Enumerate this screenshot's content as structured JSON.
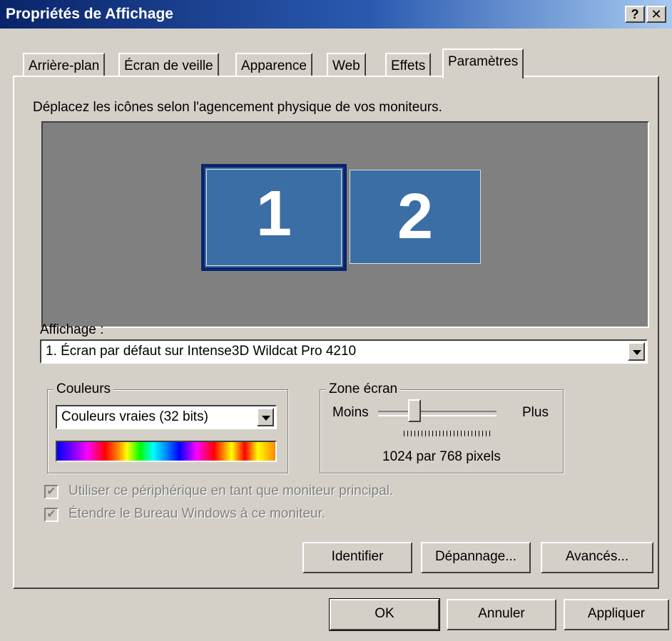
{
  "window": {
    "title": "Propriétés de Affichage",
    "help_label": "?",
    "close_label": "✕"
  },
  "tabs": [
    {
      "label": "Arrière-plan"
    },
    {
      "label": "Écran de veille"
    },
    {
      "label": "Apparence"
    },
    {
      "label": "Web"
    },
    {
      "label": "Effets"
    },
    {
      "label": "Paramètres"
    }
  ],
  "active_tab": "Paramètres",
  "settings": {
    "instruction": "Déplacez les icônes selon l'agencement physique de vos moniteurs.",
    "monitors": [
      {
        "number": "1"
      },
      {
        "number": "2"
      }
    ],
    "display_label": "Affichage :",
    "display_value": "1. Écran par défaut sur Intense3D Wildcat Pro 4210",
    "colors": {
      "legend": "Couleurs",
      "value": "Couleurs vraies (32 bits)"
    },
    "screen_area": {
      "legend": "Zone écran",
      "less": "Moins",
      "more": "Plus",
      "resolution": "1024 par 768 pixels",
      "slider_fraction": 0.2
    },
    "checkboxes": [
      {
        "label": "Utiliser ce périphérique en tant que moniteur principal.",
        "checked": true,
        "disabled": true
      },
      {
        "label": "Étendre le Bureau Windows à ce moniteur.",
        "checked": true,
        "disabled": true
      }
    ],
    "buttons": {
      "identify": "Identifier",
      "troubleshoot": "Dépannage...",
      "advanced": "Avancés..."
    }
  },
  "footer": {
    "ok": "OK",
    "cancel": "Annuler",
    "apply": "Appliquer"
  },
  "colors": {
    "titlebar_start": "#0a246a",
    "titlebar_end": "#a6caf0",
    "monitor_fill": "#3a6ea5",
    "face": "#d4d0c8"
  }
}
